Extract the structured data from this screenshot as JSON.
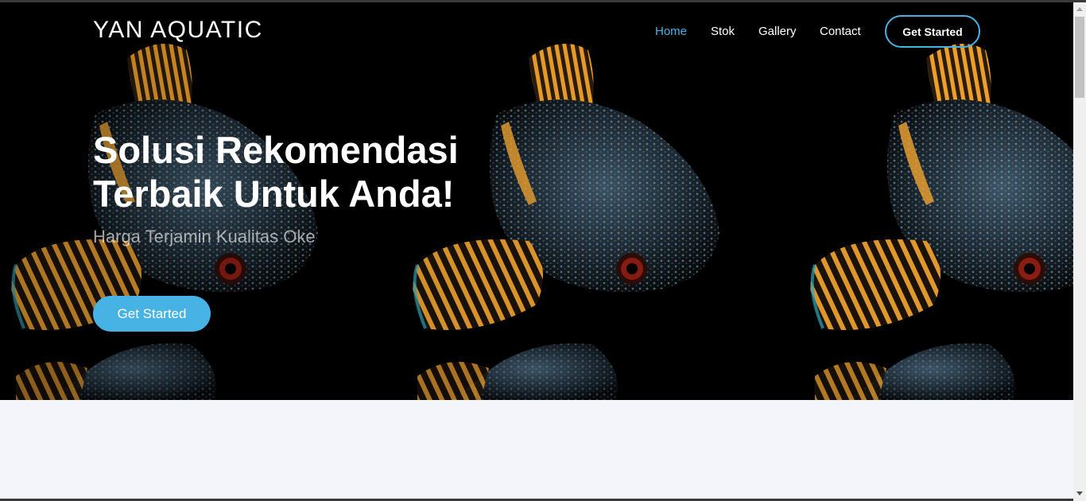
{
  "brand": {
    "name": "YAN AQUATIC"
  },
  "nav": {
    "items": [
      {
        "label": "Home",
        "active": true
      },
      {
        "label": "Stok",
        "active": false
      },
      {
        "label": "Gallery",
        "active": false
      },
      {
        "label": "Contact",
        "active": false
      }
    ],
    "cta_label": "Get Started"
  },
  "hero": {
    "title_line1": "Solusi Rekomendasi",
    "title_line2": "Terbaik Untuk Anda!",
    "subtitle": "Harga Terjamin Kualitas Oke",
    "button_label": "Get Started",
    "background_image": "snakehead-fish-pattern"
  },
  "colors": {
    "accent": "#47b2e4",
    "hero_background": "#000000",
    "page_background": "#f3f5fa"
  }
}
